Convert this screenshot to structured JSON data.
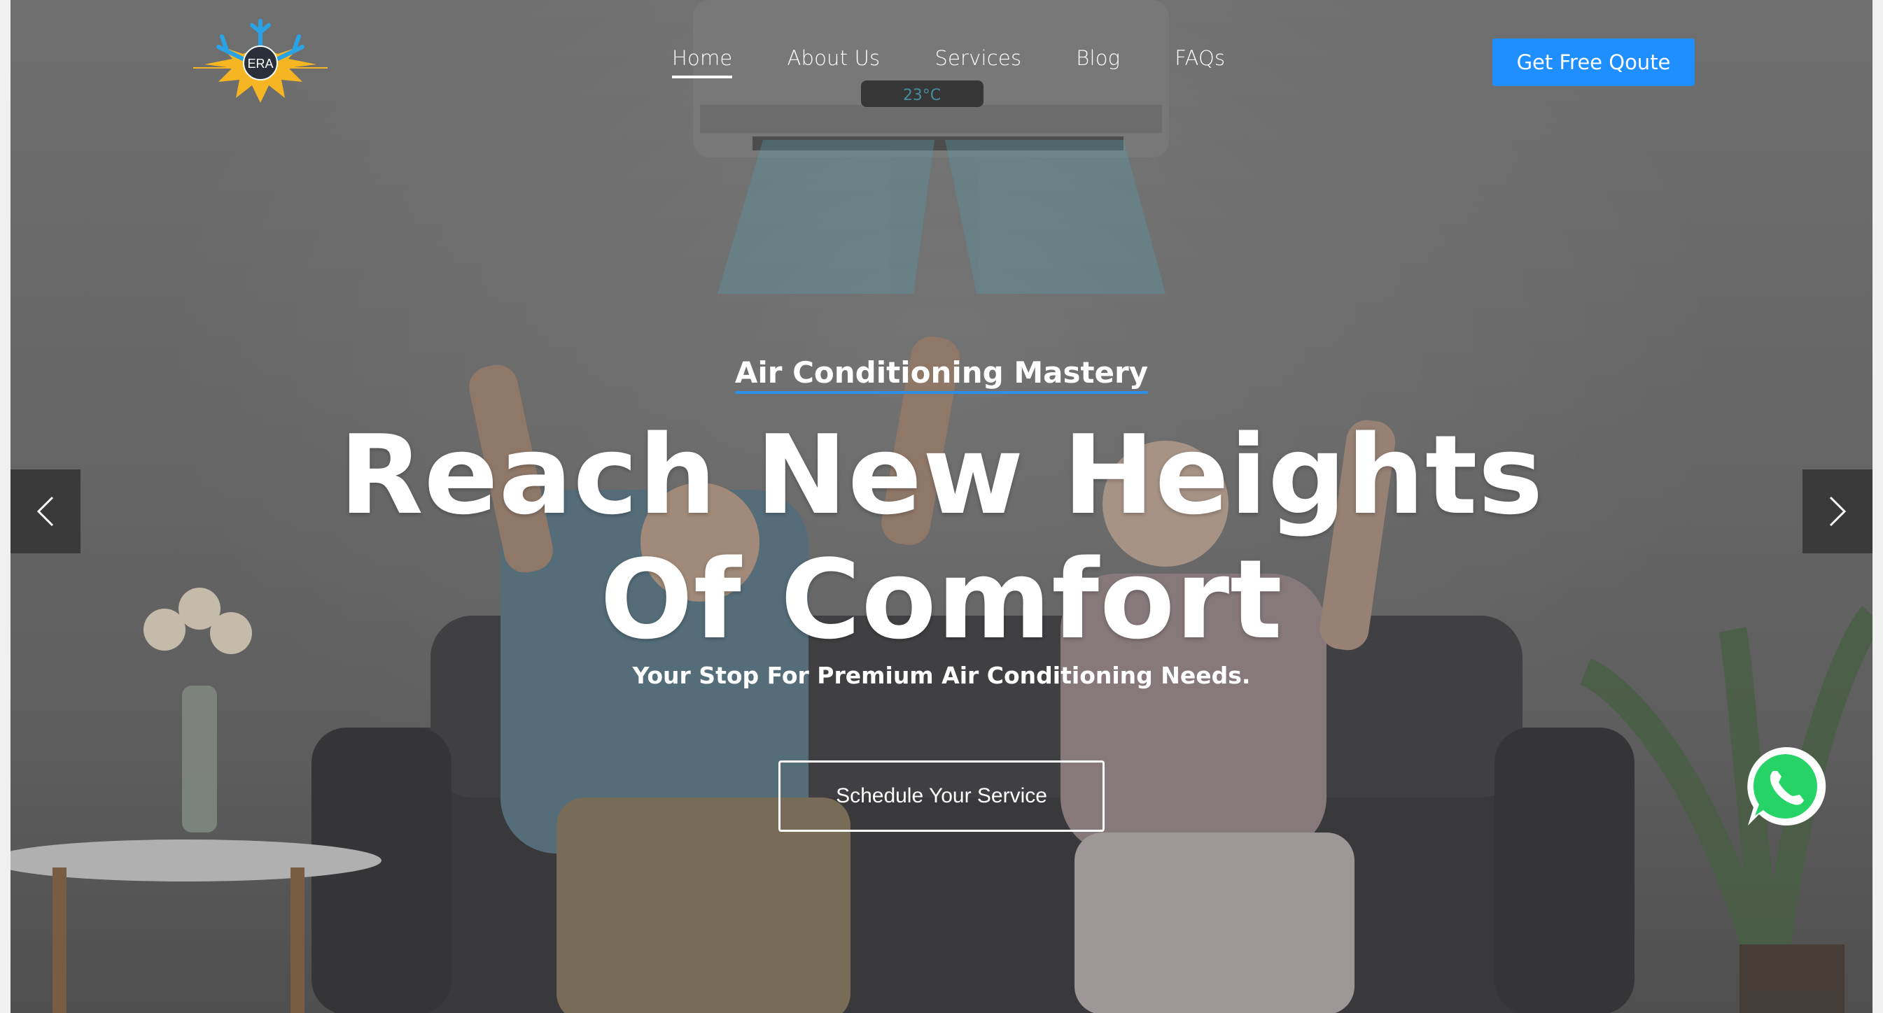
{
  "brand": {
    "logo_text": "ERA",
    "colors": {
      "snowflake": "#2aa3e6",
      "sun": "#f6b623"
    }
  },
  "nav": {
    "items": [
      {
        "label": "Home",
        "active": true
      },
      {
        "label": "About Us",
        "active": false
      },
      {
        "label": "Services",
        "active": false
      },
      {
        "label": "Blog",
        "active": false
      },
      {
        "label": "FAQs",
        "active": false
      }
    ]
  },
  "header": {
    "cta_label": "Get Free Qoute",
    "cta_color": "#1f8fff"
  },
  "hero": {
    "ac_display": "23°C",
    "eyebrow": "Air Conditioning Mastery",
    "headline_line1": "Reach New Heights",
    "headline_line2": "Of Comfort",
    "subheadline": "Your Stop For Premium Air Conditioning Needs.",
    "button_label": "Schedule Your Service"
  },
  "slider": {
    "prev_icon": "chevron-left-icon",
    "next_icon": "chevron-right-icon"
  },
  "floating": {
    "whatsapp_icon": "whatsapp-icon",
    "whatsapp_color": "#25d366"
  }
}
